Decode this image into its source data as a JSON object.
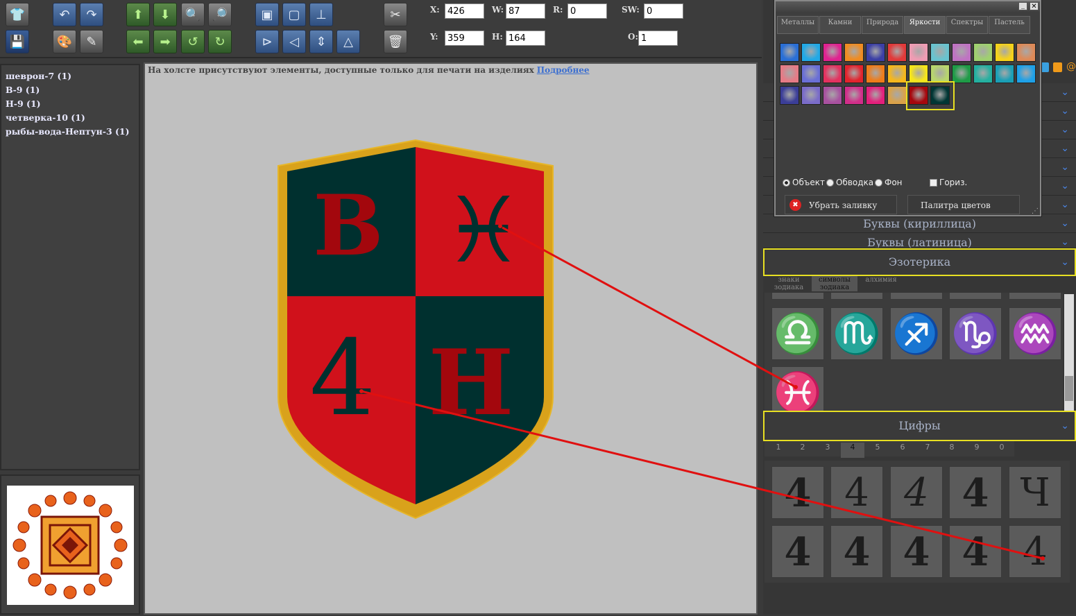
{
  "toolbar": {
    "fields": {
      "x": {
        "label": "X:",
        "value": "426"
      },
      "w": {
        "label": "W:",
        "value": "87"
      },
      "r": {
        "label": "R:",
        "value": "0"
      },
      "sw": {
        "label": "SW:",
        "value": "0"
      },
      "y": {
        "label": "Y:",
        "value": "359"
      },
      "h": {
        "label": "H:",
        "value": "164"
      },
      "o": {
        "label": "O:",
        "value": "1"
      }
    }
  },
  "layers": [
    "шеврон-7 (1)",
    "В-9 (1)",
    "Н-9 (1)",
    "четверка-10 (1)",
    "рыбы-вода-Нептун-3 (1)"
  ],
  "canvas": {
    "notice": "На холсте присутствуют элементы, доступные только для печати на изделиях",
    "notice_link": "Подробнее",
    "shield": {
      "colors": {
        "red": "#d0111b",
        "dark": "#00302f",
        "gold": "#d9a21b",
        "glyph": "#a3070d"
      },
      "glyph_tl": "В",
      "glyph_tr": "♓",
      "glyph_bl": "4",
      "glyph_br": "Н"
    }
  },
  "palette": {
    "tabs": [
      "Металлы",
      "Камни",
      "Природа",
      "Яркости",
      "Спектры",
      "Пастель"
    ],
    "active_tab": "Яркости",
    "swatches": [
      "#2a6fd6",
      "#22a9e6",
      "#e02290",
      "#ef8c22",
      "#3b3fa6",
      "#e23a3a",
      "#ee9cb3",
      "#69c3cf",
      "#bf73c2",
      "#9fd06f",
      "#f5d21b",
      "#dd8a58",
      "#e57b86",
      "#6a6fd6",
      "#e3315f",
      "#e3232d",
      "#ef7c19",
      "#f6b71b",
      "#f6e51a",
      "#b8d66d",
      "#1e9b46",
      "#24b0a0",
      "#1a9fb6",
      "#1ea1e8",
      "#3b3e98",
      "#7a6cc9",
      "#a8519f",
      "#d12e8a",
      "#e41f7c",
      "#d9a24a",
      "#a6070d",
      "#003634"
    ],
    "radio_object": "Объект",
    "radio_stroke": "Обводка",
    "radio_bg": "Фон",
    "checkbox_horiz": "Гориз.",
    "remove_fill": "Убрать заливку",
    "color_palette": "Палитра цветов"
  },
  "accordion": {
    "cyrillic": "Буквы (кириллица)",
    "latin": "Буквы (латиница)",
    "esoteric": "Эзотерика",
    "digits": "Цифры"
  },
  "esoteric_tabs": [
    "знаки зодиака",
    "символы зодиака",
    "алхимия"
  ],
  "zodiac_symbols": [
    "♎",
    "♏",
    "♐",
    "♑",
    "♒",
    "♓"
  ],
  "digit_tabs": [
    "1",
    "2",
    "3",
    "4",
    "5",
    "6",
    "7",
    "8",
    "9",
    "0"
  ],
  "digit_glyphs": [
    "4",
    "4",
    "4",
    "4",
    "Ч",
    "4",
    "4",
    "4",
    "4",
    "4"
  ]
}
